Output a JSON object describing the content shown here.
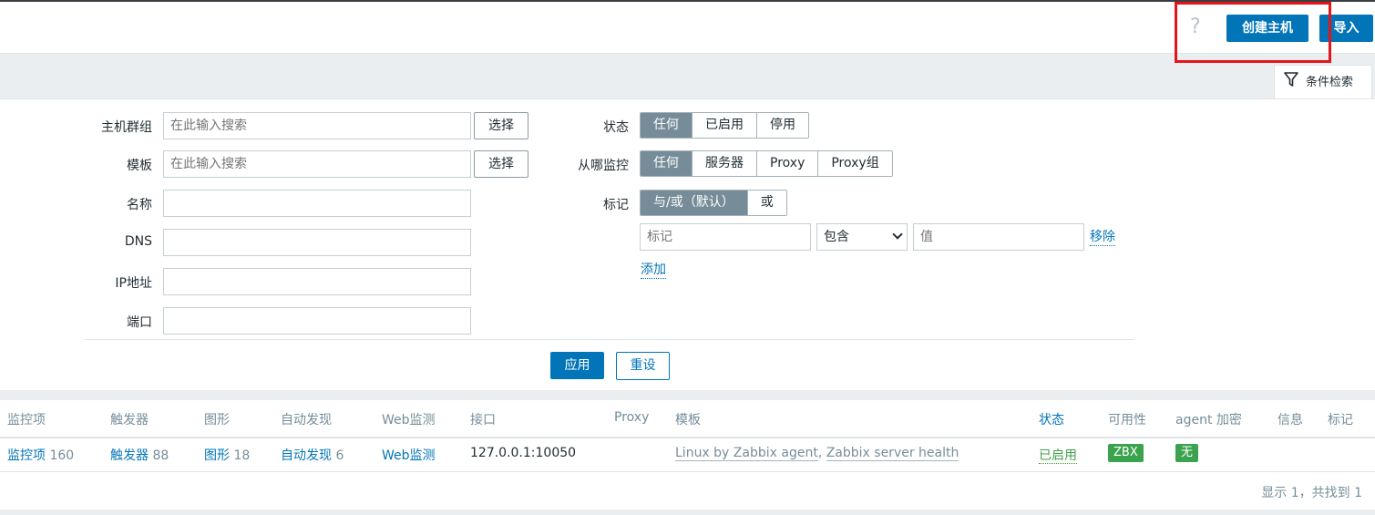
{
  "header": {
    "help": "?",
    "create_host": "创建主机",
    "import": "导入"
  },
  "filter_tab": {
    "label": "条件检索",
    "icon": "filter-icon"
  },
  "filter": {
    "host_groups": {
      "label": "主机群组",
      "placeholder": "在此输入搜索",
      "select": "选择"
    },
    "templates": {
      "label": "模板",
      "placeholder": "在此输入搜索",
      "select": "选择"
    },
    "name": {
      "label": "名称",
      "value": ""
    },
    "dns": {
      "label": "DNS",
      "value": ""
    },
    "ip": {
      "label": "IP地址",
      "value": ""
    },
    "port": {
      "label": "端口",
      "value": ""
    },
    "status": {
      "label": "状态",
      "options": [
        "任何",
        "已启用",
        "停用"
      ],
      "selected": "任何"
    },
    "monitored_by": {
      "label": "从哪监控",
      "options": [
        "任何",
        "服务器",
        "Proxy",
        "Proxy组"
      ],
      "selected": "任何"
    },
    "tags": {
      "label": "标记",
      "options": [
        "与/或（默认）",
        "或"
      ],
      "selected": "与/或（默认）",
      "tag_placeholder": "标记",
      "operator": "包含",
      "value_placeholder": "值",
      "remove": "移除",
      "add": "添加"
    },
    "apply": "应用",
    "reset": "重设"
  },
  "table": {
    "columns": [
      "监控项",
      "触发器",
      "图形",
      "自动发现",
      "Web监测",
      "接口",
      "Proxy",
      "模板",
      "状态",
      "可用性",
      "agent 加密",
      "信息",
      "标记"
    ],
    "row": {
      "items_label": "监控项",
      "items_count": "160",
      "triggers_label": "触发器",
      "triggers_count": "88",
      "graphs_label": "图形",
      "graphs_count": "18",
      "discovery_label": "自动发现",
      "discovery_count": "6",
      "web_label": "Web监测",
      "interface": "127.0.0.1:10050",
      "template_1": "Linux by Zabbix agent",
      "template_sep": ",",
      "template_2": "Zabbix server health",
      "status": "已启用",
      "availability": "ZBX",
      "encryption": "无"
    },
    "footer": "显示 1，共找到 1"
  },
  "colors": {
    "primary": "#0275b8",
    "highlight_border": "#e3151a",
    "segment_active": "#768d99",
    "status_enabled": "#429e47",
    "badge_green": "#3ba24e"
  }
}
